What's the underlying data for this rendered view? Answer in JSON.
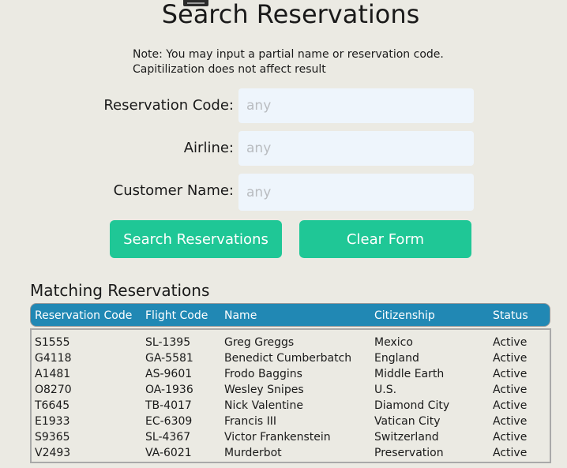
{
  "page": {
    "title": "Search Reservations",
    "note_line1": "Note: You may input a partial name or reservation code.",
    "note_line2": "Capitilization does not affect result"
  },
  "form": {
    "reservation_code": {
      "label": "Reservation Code:",
      "value": "",
      "placeholder": "any"
    },
    "airline": {
      "label": "Airline:",
      "value": "",
      "placeholder": "any"
    },
    "customer_name": {
      "label": "Customer Name:",
      "value": "",
      "placeholder": "any"
    }
  },
  "buttons": {
    "search": "Search Reservations",
    "clear": "Clear Form"
  },
  "results": {
    "title": "Matching Reservations",
    "columns": [
      "Reservation Code",
      "Flight Code",
      "Name",
      "Citizenship",
      "Status"
    ],
    "rows": [
      [
        "S1555",
        "SL-1395",
        "Greg Greggs",
        "Mexico",
        "Active"
      ],
      [
        "G4118",
        "GA-5581",
        "Benedict Cumberbatch",
        "England",
        "Active"
      ],
      [
        "A1481",
        "AS-9601",
        "Frodo Baggins",
        "Middle Earth",
        "Active"
      ],
      [
        "O8270",
        "OA-1936",
        "Wesley Snipes",
        "U.S.",
        "Active"
      ],
      [
        "T6645",
        "TB-4017",
        "Nick Valentine",
        "Diamond City",
        "Active"
      ],
      [
        "E1933",
        "EC-6309",
        "Francis III",
        "Vatican City",
        "Active"
      ],
      [
        "S9365",
        "SL-4367",
        "Victor Frankenstein",
        "Switzerland",
        "Active"
      ],
      [
        "V2493",
        "VA-6021",
        "Murderbot",
        "Preservation",
        "Active"
      ]
    ]
  },
  "colors": {
    "background": "#ebeae3",
    "accent_button": "#1fc796",
    "table_header": "#2188b4",
    "input_background": "#eef5fc"
  },
  "icons": {
    "top": "bookmark-tab-icon"
  }
}
